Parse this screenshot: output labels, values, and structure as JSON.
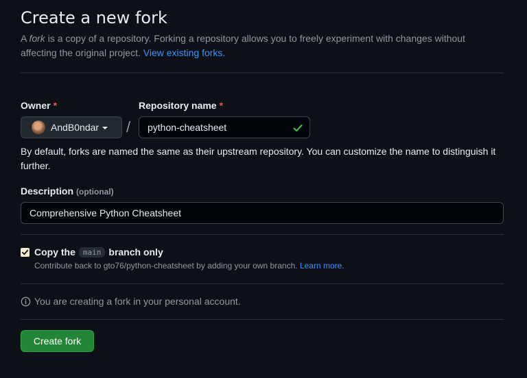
{
  "header": {
    "title": "Create a new fork",
    "intro_prefix": "A ",
    "intro_em": "fork",
    "intro_rest": " is a copy of a repository. Forking a repository allows you to freely experiment with changes without affecting the original project. ",
    "intro_link": "View existing forks."
  },
  "owner": {
    "label": "Owner",
    "required_mark": "*",
    "value": "AndB0ndar"
  },
  "separator": "/",
  "repo_name": {
    "label": "Repository name",
    "required_mark": "*",
    "value": "python-cheatsheet",
    "valid_icon": "check-icon"
  },
  "hint": "By default, forks are named the same as their upstream repository. You can customize the name to distinguish it further.",
  "description": {
    "label": "Description",
    "optional": "(optional)",
    "value": "Comprehensive Python Cheatsheet"
  },
  "copy_branch": {
    "checked": true,
    "label_prefix": "Copy the",
    "branch": "main",
    "label_suffix": "branch only",
    "sub_text": "Contribute back to gto76/python-cheatsheet by adding your own branch.",
    "learn_more": "Learn more."
  },
  "info": {
    "icon": "info-icon",
    "text": "You are creating a fork in your personal account."
  },
  "actions": {
    "create_label": "Create fork"
  },
  "colors": {
    "background": "#0d1117",
    "link": "#4493f8",
    "primary_button": "#238636",
    "required": "#f85149",
    "success": "#3fb950"
  }
}
